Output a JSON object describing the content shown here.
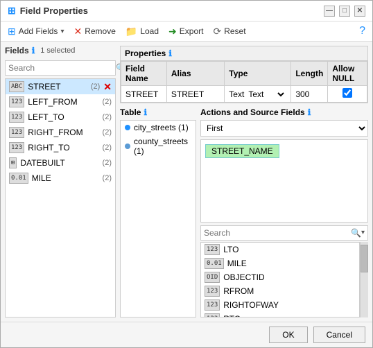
{
  "window": {
    "title": "Field Properties"
  },
  "toolbar": {
    "add_label": "Add Fields",
    "remove_label": "Remove",
    "load_label": "Load",
    "export_label": "Export",
    "reset_label": "Reset"
  },
  "fields_panel": {
    "label": "Fields",
    "selected_text": "1 selected",
    "search_placeholder": "Search"
  },
  "fields_list": [
    {
      "type": "ABC",
      "name": "STREET",
      "count": "(2)",
      "selected": true,
      "deletable": true
    },
    {
      "type": "123",
      "name": "LEFT_FROM",
      "count": "(2)",
      "selected": false
    },
    {
      "type": "123",
      "name": "LEFT_TO",
      "count": "(2)",
      "selected": false
    },
    {
      "type": "123",
      "name": "RIGHT_FROM",
      "count": "(2)",
      "selected": false
    },
    {
      "type": "123",
      "name": "RIGHT_TO",
      "count": "(2)",
      "selected": false
    },
    {
      "type": "GRID",
      "name": "DATEBUILT",
      "count": "(2)",
      "selected": false
    },
    {
      "type": "0.01",
      "name": "MILE",
      "count": "(2)",
      "selected": false
    }
  ],
  "properties_panel": {
    "label": "Properties",
    "table_header": [
      "Field Name",
      "Alias",
      "Type",
      "Length",
      "Allow NULL"
    ],
    "row": {
      "field_name": "STREET",
      "alias": "STREET",
      "type": "Text",
      "length": "300",
      "allow_null": true
    }
  },
  "table_section": {
    "label": "Table",
    "items": [
      {
        "name": "city_streets",
        "count": "(1)",
        "color": "blue"
      },
      {
        "name": "county_streets",
        "count": "(1)",
        "color": "teal"
      }
    ]
  },
  "actions_section": {
    "label": "Actions and Source Fields",
    "dropdown_value": "First",
    "source_fields": [
      "STREET_NAME"
    ],
    "search_placeholder": "Search",
    "available_fields": [
      {
        "type": "123",
        "name": "LTO"
      },
      {
        "type": "0.01",
        "name": "MILE"
      },
      {
        "type": "OID",
        "name": "OBJECTID"
      },
      {
        "type": "123",
        "name": "RFROM"
      },
      {
        "type": "123",
        "name": "RIGHTOFWAY"
      },
      {
        "type": "123",
        "name": "RTO"
      }
    ]
  },
  "buttons": {
    "ok": "OK",
    "cancel": "Cancel"
  }
}
